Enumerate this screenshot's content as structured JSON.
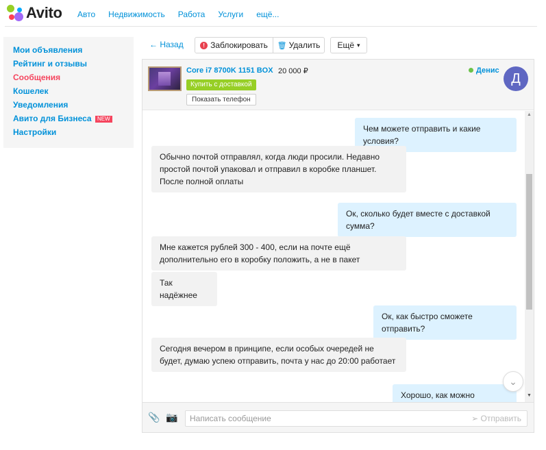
{
  "header": {
    "logo_text": "Avito",
    "nav": [
      "Авто",
      "Недвижимость",
      "Работа",
      "Услуги",
      "ещё..."
    ]
  },
  "sidebar": {
    "items": [
      {
        "label": "Мои объявления"
      },
      {
        "label": "Рейтинг и отзывы"
      },
      {
        "label": "Сообщения"
      },
      {
        "label": "Кошелек"
      },
      {
        "label": "Уведомления"
      },
      {
        "label": "Авито для Бизнеса"
      },
      {
        "label": "Настройки"
      }
    ],
    "badge": "NEW"
  },
  "toolbar": {
    "back": "← Назад",
    "block": "Заблокировать",
    "delete": "Удалить",
    "more": "Ещё"
  },
  "chat": {
    "product_title": "Core i7 8700K 1151 BOX",
    "price": "20 000 ₽",
    "buy_label": "Купить с доставкой",
    "phone_label": "Показать телефон",
    "user_name": "Денис",
    "avatar_letter": "Д",
    "messages": [
      {
        "dir": "out",
        "text": "Чем можете отправить и какие условия?"
      },
      {
        "dir": "in",
        "text": "Обычно почтой отправлял, когда люди просили. Недавно простой почтой упаковал и отправил в коробке планшет. После полной оплаты"
      },
      {
        "dir": "out",
        "text": "Ок, сколько будет вместе с доставкой сумма?"
      },
      {
        "dir": "in",
        "text": "Мне кажется рублей 300 - 400, если на почте ещё дополнительно его в коробку положить, а не в пакет"
      },
      {
        "dir": "in",
        "text": "Так надёжнее"
      },
      {
        "dir": "out",
        "text": "Ок, как быстро сможете отправить?"
      },
      {
        "dir": "in",
        "text": "Сегодня вечером в принципе, если особых очередей не будет, думаю успею отправить, почта у нас до 20:00 работает"
      },
      {
        "dir": "out",
        "text": "Хорошо, как можно оплатить?"
      }
    ],
    "composer_placeholder": "Написать сообщение",
    "send_label": "Отправить"
  },
  "colors": {
    "link": "#0091d9",
    "active": "#f5455e",
    "buy": "#97cf26",
    "outgoing": "#ddf2ff",
    "incoming": "#f2f2f2",
    "avatar": "#5f67c2"
  },
  "icons": {
    "clip": "paperclip-icon",
    "camera": "camera-icon",
    "block": "stop-icon",
    "delete": "trash-icon",
    "send": "send-icon",
    "scroll": "chevron-down-icon"
  }
}
